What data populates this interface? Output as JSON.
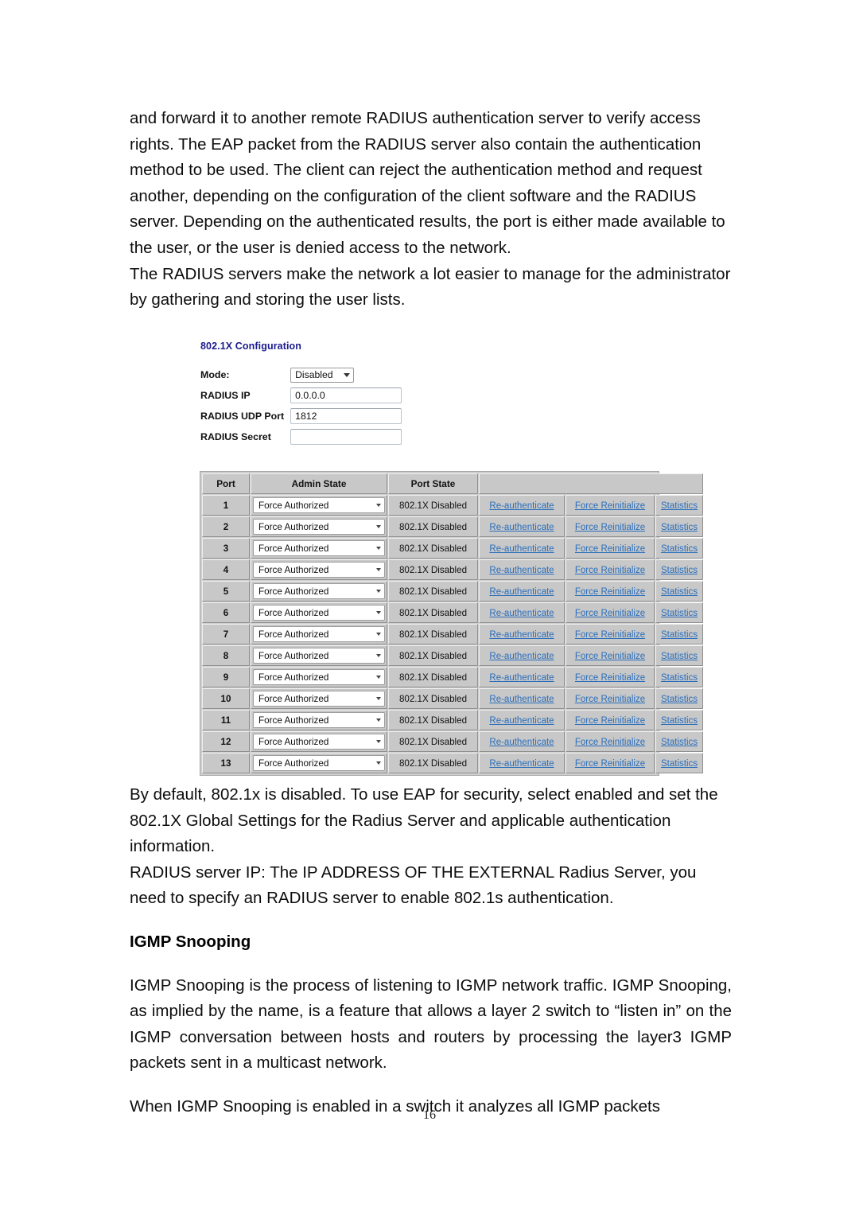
{
  "document": {
    "page_number": "16",
    "paragraphs": [
      "and forward it to another remote RADIUS authentication server to verify access rights. The EAP packet from the RADIUS server also contain the authentication method to be used. The client can reject the authentication method and request another, depending on the configuration of the client software and the RADIUS server. Depending on the authenticated results, the port is either made available to the user, or the user is denied access to the network.",
      "The RADIUS servers make the network a lot easier to manage for the administrator by gathering and storing the user lists."
    ],
    "paragraphs_after": [
      "By default, 802.1x is disabled. To use EAP for security, select enabled and set the 802.1X Global Settings for the Radius Server and applicable authentication information.",
      "RADIUS server IP: The IP ADDRESS OF THE EXTERNAL Radius Server, you need to specify an RADIUS server to enable 802.1s authentication."
    ],
    "section_heading": "IGMP Snooping",
    "paragraphs_igmp": [
      "IGMP Snooping is the process of listening to IGMP network traffic. IGMP Snooping, as implied by the name, is a feature that allows a layer 2 switch to “listen in” on the IGMP conversation between hosts and routers by processing the layer3 IGMP packets sent in a multicast network.",
      "When IGMP Snooping is enabled in a switch it analyzes all IGMP packets"
    ]
  },
  "figure": {
    "title": "802.1X Configuration",
    "title_color": "#1b1b8f",
    "form": {
      "mode": {
        "label": "Mode:",
        "value": "Disabled",
        "icon": "chevron-down-icon"
      },
      "radius_ip": {
        "label": "RADIUS IP",
        "value": "0.0.0.0"
      },
      "radius_udp_port": {
        "label": "RADIUS UDP Port",
        "value": "1812"
      },
      "radius_secret": {
        "label": "RADIUS Secret",
        "value": ""
      }
    },
    "table": {
      "headers": [
        "Port",
        "Admin State",
        "Port State",
        "",
        "",
        ""
      ],
      "link_color": "#2a6ebb",
      "rows": [
        {
          "port": "1",
          "admin_state": "Force Authorized",
          "port_state": "802.1X Disabled",
          "reauthenticate": "Re-authenticate",
          "force_reinitialize": "Force Reinitialize",
          "statistics": "Statistics"
        },
        {
          "port": "2",
          "admin_state": "Force Authorized",
          "port_state": "802.1X Disabled",
          "reauthenticate": "Re-authenticate",
          "force_reinitialize": "Force Reinitialize",
          "statistics": "Statistics"
        },
        {
          "port": "3",
          "admin_state": "Force Authorized",
          "port_state": "802.1X Disabled",
          "reauthenticate": "Re-authenticate",
          "force_reinitialize": "Force Reinitialize",
          "statistics": "Statistics"
        },
        {
          "port": "4",
          "admin_state": "Force Authorized",
          "port_state": "802.1X Disabled",
          "reauthenticate": "Re-authenticate",
          "force_reinitialize": "Force Reinitialize",
          "statistics": "Statistics"
        },
        {
          "port": "5",
          "admin_state": "Force Authorized",
          "port_state": "802.1X Disabled",
          "reauthenticate": "Re-authenticate",
          "force_reinitialize": "Force Reinitialize",
          "statistics": "Statistics"
        },
        {
          "port": "6",
          "admin_state": "Force Authorized",
          "port_state": "802.1X Disabled",
          "reauthenticate": "Re-authenticate",
          "force_reinitialize": "Force Reinitialize",
          "statistics": "Statistics"
        },
        {
          "port": "7",
          "admin_state": "Force Authorized",
          "port_state": "802.1X Disabled",
          "reauthenticate": "Re-authenticate",
          "force_reinitialize": "Force Reinitialize",
          "statistics": "Statistics"
        },
        {
          "port": "8",
          "admin_state": "Force Authorized",
          "port_state": "802.1X Disabled",
          "reauthenticate": "Re-authenticate",
          "force_reinitialize": "Force Reinitialize",
          "statistics": "Statistics"
        },
        {
          "port": "9",
          "admin_state": "Force Authorized",
          "port_state": "802.1X Disabled",
          "reauthenticate": "Re-authenticate",
          "force_reinitialize": "Force Reinitialize",
          "statistics": "Statistics"
        },
        {
          "port": "10",
          "admin_state": "Force Authorized",
          "port_state": "802.1X Disabled",
          "reauthenticate": "Re-authenticate",
          "force_reinitialize": "Force Reinitialize",
          "statistics": "Statistics"
        },
        {
          "port": "11",
          "admin_state": "Force Authorized",
          "port_state": "802.1X Disabled",
          "reauthenticate": "Re-authenticate",
          "force_reinitialize": "Force Reinitialize",
          "statistics": "Statistics"
        },
        {
          "port": "12",
          "admin_state": "Force Authorized",
          "port_state": "802.1X Disabled",
          "reauthenticate": "Re-authenticate",
          "force_reinitialize": "Force Reinitialize",
          "statistics": "Statistics"
        },
        {
          "port": "13",
          "admin_state": "Force Authorized",
          "port_state": "802.1X Disabled",
          "reauthenticate": "Re-authenticate",
          "force_reinitialize": "Force Reinitialize",
          "statistics": "Statistics"
        }
      ]
    }
  }
}
